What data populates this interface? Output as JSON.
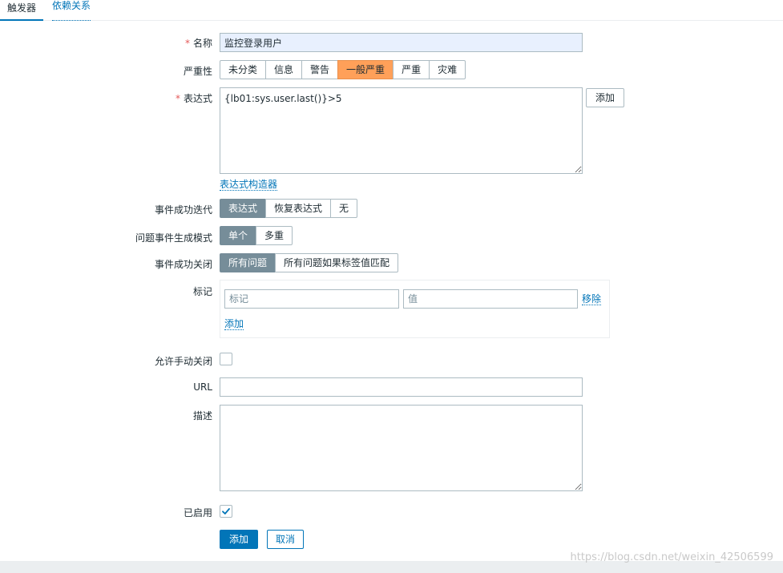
{
  "tabs": [
    {
      "label": "触发器",
      "active": true
    },
    {
      "label": "依赖关系",
      "active": false
    }
  ],
  "form": {
    "name": {
      "label": "名称",
      "required": "*",
      "value": "监控登录用户"
    },
    "severity": {
      "label": "严重性",
      "options": [
        "未分类",
        "信息",
        "警告",
        "一般严重",
        "严重",
        "灾难"
      ],
      "selected": "一般严重"
    },
    "expression": {
      "label": "表达式",
      "required": "*",
      "value": "{lb01:sys.user.last()}>5",
      "add_button": "添加"
    },
    "expression_builder_link": "表达式构造器",
    "ok_event_generation": {
      "label": "事件成功迭代",
      "options": [
        "表达式",
        "恢复表达式",
        "无"
      ],
      "selected": "表达式"
    },
    "problem_mode": {
      "label": "问题事件生成模式",
      "options": [
        "单个",
        "多重"
      ],
      "selected": "单个"
    },
    "ok_event_close": {
      "label": "事件成功关闭",
      "options": [
        "所有问题",
        "所有问题如果标签值匹配"
      ],
      "selected": "所有问题"
    },
    "tags": {
      "label": "标记",
      "tag_placeholder": "标记",
      "value_placeholder": "值",
      "remove_link": "移除",
      "add_link": "添加"
    },
    "manual_close": {
      "label": "允许手动关闭",
      "checked": false
    },
    "url": {
      "label": "URL",
      "value": ""
    },
    "description": {
      "label": "描述",
      "value": ""
    },
    "enabled": {
      "label": "已启用",
      "checked": true
    },
    "submit_button": "添加",
    "cancel_button": "取消"
  },
  "watermark": "https://blog.csdn.net/weixin_42506599",
  "colors": {
    "accent": "#0275b8",
    "severity_average": "#ffa059",
    "segment_selected": "#768d99",
    "required": "#e45959"
  },
  "icons": {
    "check": "check-icon"
  }
}
